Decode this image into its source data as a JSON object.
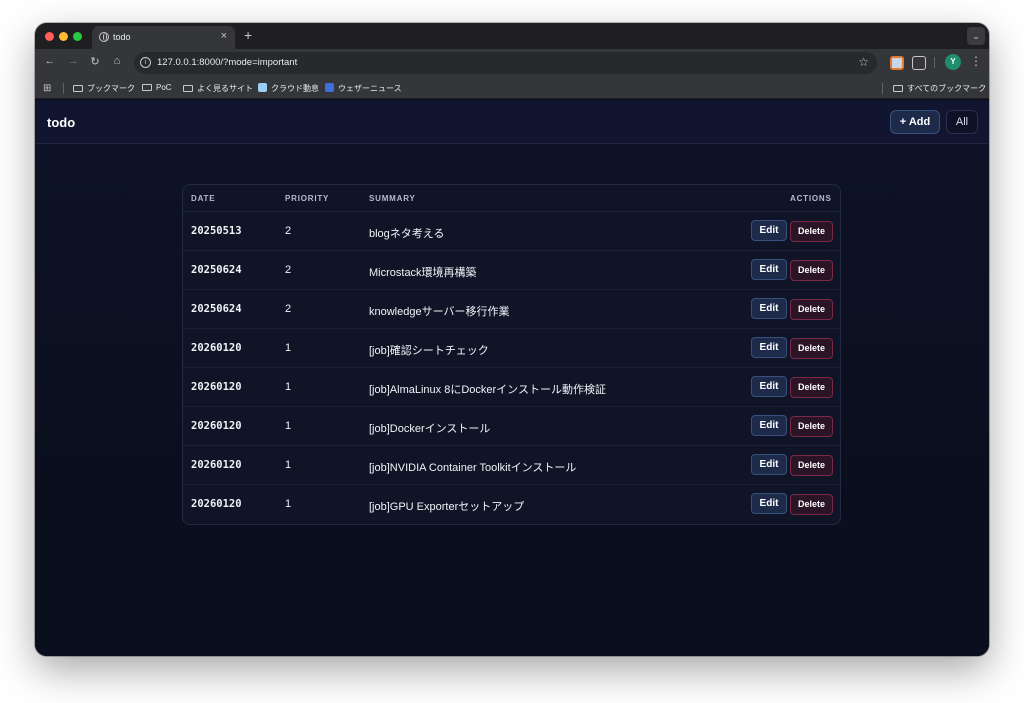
{
  "browser": {
    "tab_title": "todo",
    "tab_close": "×",
    "new_tab": "+",
    "url": "127.0.0.1:8000/?mode=important",
    "bookmarks": [
      "ブックマーク",
      "PoC",
      "よく見るサイト",
      "クラウド動息",
      "ウェザーニュース"
    ],
    "all_bookmarks": "すべてのブックマーク",
    "profile_initial": "Y"
  },
  "app": {
    "brand": "todo",
    "add_label": "+ Add",
    "all_label": "All"
  },
  "table": {
    "headers": {
      "date": "DATE",
      "priority": "PRIORITY",
      "summary": "SUMMARY",
      "actions": "ACTIONS"
    },
    "edit_label": "Edit",
    "delete_label": "Delete",
    "rows": [
      {
        "date": "20250513",
        "priority": "2",
        "summary": "blogネタ考える"
      },
      {
        "date": "20250624",
        "priority": "2",
        "summary": "Microstack環境再構築"
      },
      {
        "date": "20250624",
        "priority": "2",
        "summary": "knowledgeサーバー移行作業"
      },
      {
        "date": "20260120",
        "priority": "1",
        "summary": "[job]確認シートチェック"
      },
      {
        "date": "20260120",
        "priority": "1",
        "summary": "[job]AlmaLinux 8にDockerインストール動作検証"
      },
      {
        "date": "20260120",
        "priority": "1",
        "summary": "[job]Dockerインストール"
      },
      {
        "date": "20260120",
        "priority": "1",
        "summary": "[job]NVIDIA Container Toolkitインストール"
      },
      {
        "date": "20260120",
        "priority": "1",
        "summary": "[job]GPU Exporterセットアップ"
      }
    ]
  }
}
